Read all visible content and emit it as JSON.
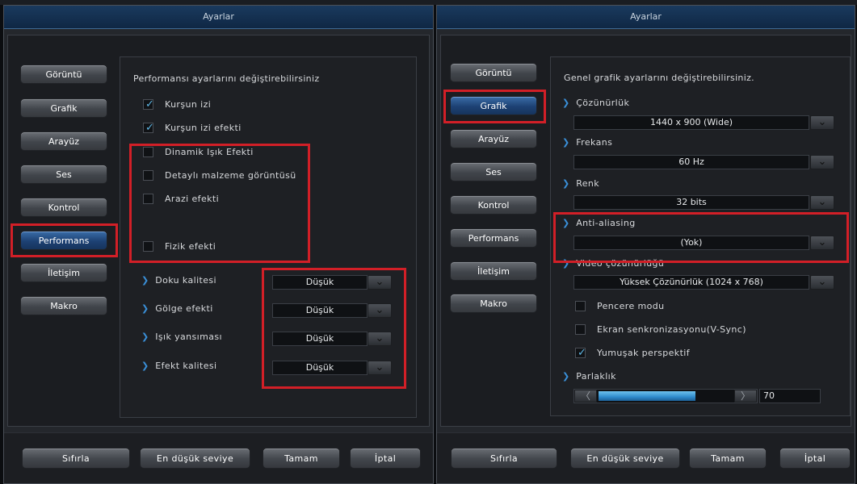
{
  "left": {
    "title": "Ayarlar",
    "nav": [
      "Görüntü",
      "Grafik",
      "Arayüz",
      "Ses",
      "Kontrol",
      "Performans",
      "İletişim",
      "Makro"
    ],
    "panel_title": "Performansı ayarlarını değiştirebilirsiniz",
    "checkboxes": [
      {
        "label": "Kurşun izi",
        "checked": true
      },
      {
        "label": "Kurşun izi efekti",
        "checked": true
      },
      {
        "label": "Dinamik Işık Efekti",
        "checked": false
      },
      {
        "label": "Detaylı malzeme görüntüsü",
        "checked": false
      },
      {
        "label": "Arazi efekti",
        "checked": false
      },
      {
        "label": "Fizik efekti",
        "checked": false
      }
    ],
    "quality": [
      {
        "label": "Doku kalitesi",
        "value": "Düşük"
      },
      {
        "label": "Gölge efekti",
        "value": "Düşük"
      },
      {
        "label": "Işık yansıması",
        "value": "Düşük"
      },
      {
        "label": "Efekt kalitesi",
        "value": "Düşük"
      }
    ],
    "buttons": [
      "Sıfırla",
      "En düşük seviye",
      "Tamam",
      "İptal"
    ]
  },
  "right": {
    "title": "Ayarlar",
    "nav": [
      "Görüntü",
      "Grafik",
      "Arayüz",
      "Ses",
      "Kontrol",
      "Performans",
      "İletişim",
      "Makro"
    ],
    "panel_title": "Genel grafik ayarlarını değiştirebilirsiniz.",
    "settings": [
      {
        "label": "Çözünürlük",
        "value": "1440 x 900 (Wide)"
      },
      {
        "label": "Frekans",
        "value": "60 Hz"
      },
      {
        "label": "Renk",
        "value": "32 bits"
      },
      {
        "label": "Anti-aliasing",
        "value": "(Yok)"
      },
      {
        "label": "Video çözünürlüğü",
        "value": "Yüksek Çözünürlük (1024 x 768)"
      }
    ],
    "checkboxes": [
      {
        "label": "Pencere modu",
        "checked": false
      },
      {
        "label": "Ekran senkronizasyonu(V-Sync)",
        "checked": false
      },
      {
        "label": "Yumuşak perspektif",
        "checked": true
      }
    ],
    "brightness": {
      "label": "Parlaklık",
      "value": "70"
    },
    "buttons": [
      "Sıfırla",
      "En düşük seviye",
      "Tamam",
      "İptal"
    ]
  },
  "colors": {
    "accent": "#3a8fd8",
    "highlight": "#d21f27",
    "active_nav": "#1d4173"
  }
}
